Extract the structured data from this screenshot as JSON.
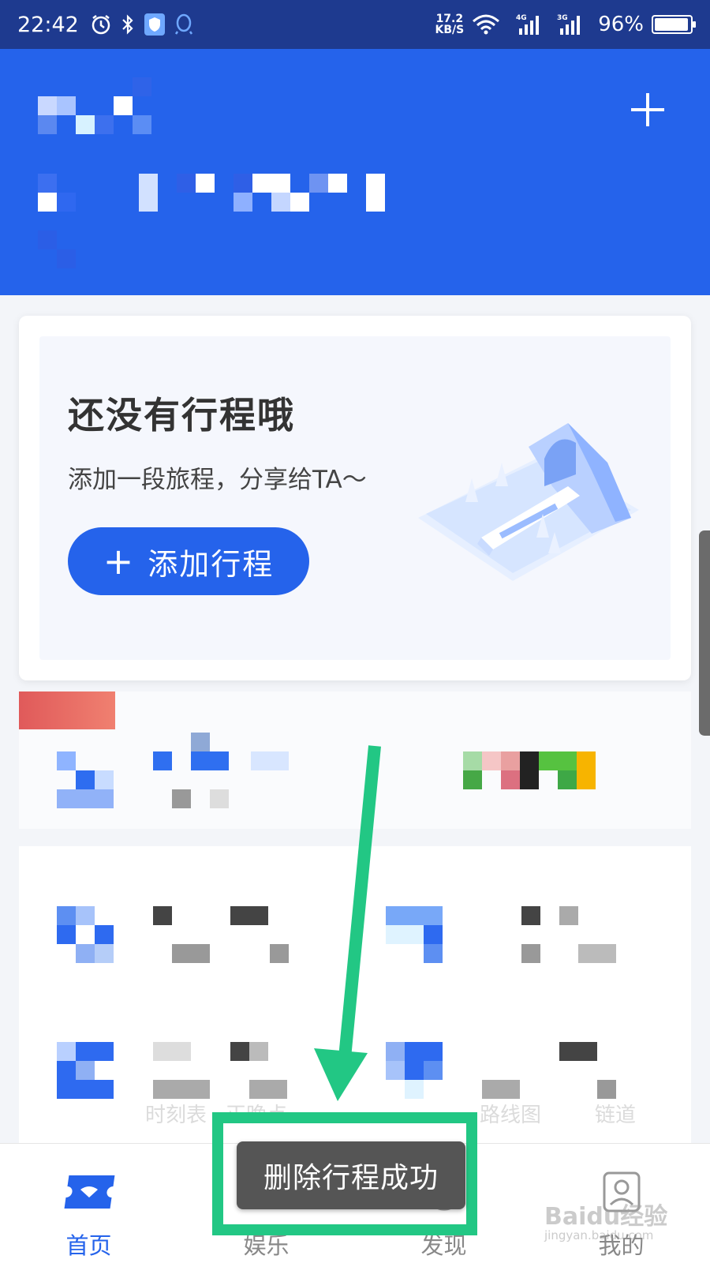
{
  "status_bar": {
    "time": "22:42",
    "net_speed_value": "17.2",
    "net_speed_unit": "KB/S",
    "net_4g": "4G",
    "net_3g": "3G",
    "battery": "96%",
    "battery_level": 0.96,
    "icons": [
      "alarm-icon",
      "bluetooth-icon",
      "shield-icon",
      "qq-icon",
      "wifi-icon",
      "signal-icon",
      "battery-icon"
    ]
  },
  "header": {
    "add_icon": "plus-icon",
    "background": "#2563eb"
  },
  "trip_card": {
    "title": "还没有行程哦",
    "subtitle": "添加一段旅程，分享给TA～",
    "add_button_label": "添加行程",
    "illustration": "train-tunnel-illustration"
  },
  "blurred_labels": {
    "item1": "时刻表",
    "item2": "正晚点",
    "item3": "路线图",
    "item4": "链道"
  },
  "toast": {
    "message": "删除行程成功"
  },
  "bottom_nav": {
    "items": [
      {
        "label": "首页",
        "icon": "ticket-icon",
        "active": true
      },
      {
        "label": "娱乐",
        "icon": "play-icon",
        "active": false
      },
      {
        "label": "发现",
        "icon": "compass-icon",
        "active": false
      },
      {
        "label": "我的",
        "icon": "profile-icon",
        "active": false
      }
    ]
  },
  "watermark": {
    "brand": "Baidu经验",
    "url": "jingyan.baidu.com"
  },
  "colors": {
    "primary": "#2563eb",
    "status_bar": "#1e3a8f",
    "annotation_green": "#22c784",
    "toast_bg": "#555555"
  }
}
